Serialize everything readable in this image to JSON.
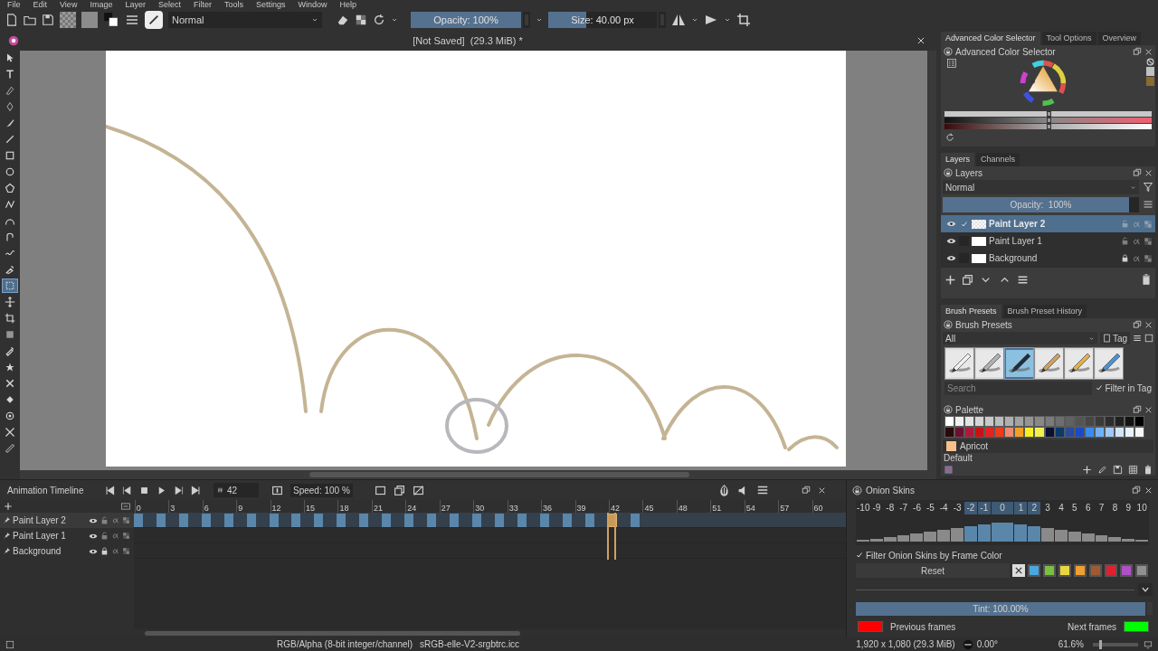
{
  "menu": [
    "File",
    "Edit",
    "View",
    "Image",
    "Layer",
    "Select",
    "Filter",
    "Tools",
    "Settings",
    "Window",
    "Help"
  ],
  "toolbar": {
    "blend_mode": "Normal",
    "opacity": {
      "text": "Opacity: 100%",
      "level": 1
    },
    "size": {
      "text": "Size: 40.00 px",
      "level": 0.35
    }
  },
  "document_tab": {
    "title": "[Not Saved]  (29.3 MiB) *"
  },
  "tools": [
    {
      "kind": "pointer",
      "selected": false
    },
    {
      "kind": "text",
      "selected": false
    },
    {
      "kind": "pen",
      "selected": false
    },
    {
      "kind": "nib",
      "selected": false
    },
    {
      "kind": "brush",
      "selected": false
    },
    {
      "kind": "line",
      "selected": false
    },
    {
      "kind": "rectangle",
      "selected": false
    },
    {
      "kind": "ellipse",
      "selected": false
    },
    {
      "kind": "polygon",
      "selected": false
    },
    {
      "kind": "polyline",
      "selected": false
    },
    {
      "kind": "bezier",
      "selected": false
    },
    {
      "kind": "hook",
      "selected": false
    },
    {
      "kind": "wave",
      "selected": false
    },
    {
      "kind": "spray",
      "selected": false
    },
    {
      "kind": "select",
      "selected": true
    },
    {
      "kind": "move",
      "selected": false
    },
    {
      "kind": "crop",
      "selected": false
    },
    {
      "kind": "gradient",
      "selected": false
    },
    {
      "kind": "eyedropper",
      "selected": false
    },
    {
      "kind": "star",
      "selected": false
    },
    {
      "kind": "patch",
      "selected": false
    },
    {
      "kind": "bucket",
      "selected": false
    },
    {
      "kind": "target",
      "selected": false
    },
    {
      "kind": "assistant",
      "selected": false
    },
    {
      "kind": "ruler",
      "selected": false
    }
  ],
  "right_dock": {
    "top_tabs": [
      {
        "label": "Advanced Color Selector",
        "selected": true
      },
      {
        "label": "Tool Options",
        "selected": false
      },
      {
        "label": "Overview",
        "selected": false
      }
    ],
    "color_selector": {
      "title": "Advanced Color Selector",
      "sliders": [
        {
          "level": 0.5
        },
        {
          "level": 0.5
        },
        {
          "level": 0.5
        }
      ]
    },
    "layer_tabs": [
      {
        "label": "Layers",
        "selected": true
      },
      {
        "label": "Channels",
        "selected": false
      }
    ],
    "layers": {
      "title": "Layers",
      "blend_mode": "Normal",
      "opacity": {
        "text": "Opacity:  100%",
        "level": 1
      },
      "items": [
        {
          "name": "Paint Layer 2",
          "selected": true,
          "checked": true,
          "locked": false
        },
        {
          "name": "Paint Layer 1",
          "selected": false,
          "checked": false,
          "locked": false
        },
        {
          "name": "Background",
          "selected": false,
          "checked": false,
          "locked": true
        }
      ]
    },
    "brush_tabs": [
      {
        "label": "Brush Presets",
        "selected": true
      },
      {
        "label": "Brush Preset History",
        "selected": false
      }
    ],
    "brush_presets": {
      "title": "Brush Presets",
      "filter": "All",
      "tag": "Tag",
      "search_placeholder": "Search",
      "filter_in_tag": {
        "label": "Filter in Tag",
        "checked": true
      },
      "items": [
        {
          "kind": "picture",
          "selected": false
        },
        {
          "kind": "picture",
          "selected": false
        },
        {
          "kind": "picture",
          "selected": true
        },
        {
          "kind": "picture",
          "selected": false
        },
        {
          "kind": "picture",
          "selected": false
        },
        {
          "kind": "picture",
          "selected": false
        }
      ]
    },
    "palette": {
      "title": "Palette",
      "colors": [
        {
          "color": "#ffffff"
        },
        {
          "color": "#f0f0f0"
        },
        {
          "color": "#e3e3e3"
        },
        {
          "color": "#d6d6d6"
        },
        {
          "color": "#c9c9c9"
        },
        {
          "color": "#bcbcbc"
        },
        {
          "color": "#afafaf"
        },
        {
          "color": "#a2a2a2"
        },
        {
          "color": "#959595"
        },
        {
          "color": "#888888"
        },
        {
          "color": "#7b7b7b"
        },
        {
          "color": "#6e6e6e"
        },
        {
          "color": "#616161"
        },
        {
          "color": "#545454"
        },
        {
          "color": "#474747"
        },
        {
          "color": "#3a3a3a"
        },
        {
          "color": "#2d2d2d"
        },
        {
          "color": "#202020"
        },
        {
          "color": "#131313"
        },
        {
          "color": "#000000"
        },
        {
          "color": "#2a0a0a"
        },
        {
          "color": "#6b1030"
        },
        {
          "color": "#b0183a"
        },
        {
          "color": "#cc1010"
        },
        {
          "color": "#e82020"
        },
        {
          "color": "#f03a18"
        },
        {
          "color": "#f08a70"
        },
        {
          "color": "#f5a020"
        },
        {
          "color": "#f8f020"
        },
        {
          "color": "#f0f050"
        },
        {
          "color": "#0a1030"
        },
        {
          "color": "#0a3a6a"
        },
        {
          "color": "#2a4a9a"
        },
        {
          "color": "#1a4ac8"
        },
        {
          "color": "#3a8af0"
        },
        {
          "color": "#70b0f8"
        },
        {
          "color": "#a0c8f8"
        },
        {
          "color": "#d0e4fa"
        },
        {
          "color": "#e8f2fc"
        },
        {
          "color": "#f4f8fc"
        }
      ],
      "current": {
        "name": "Apricot",
        "color": "#f8c08a"
      },
      "palette_name": "Default"
    }
  },
  "timeline": {
    "title": "Animation Timeline",
    "frame": "42",
    "speed": "Speed: 100 %",
    "frame_labels": [
      "0",
      "3",
      "6",
      "9",
      "12",
      "15",
      "18",
      "21",
      "24",
      "27",
      "30",
      "33",
      "36",
      "39",
      "42",
      "45",
      "48",
      "51",
      "54",
      "57",
      "60"
    ],
    "layers": [
      {
        "name": "Paint Layer 2",
        "selected": true,
        "locked": false,
        "keyframes": [
          {
            "selected": false
          },
          {
            "selected": false
          },
          {
            "selected": false
          },
          {
            "selected": false
          },
          {
            "selected": false
          },
          {
            "selected": false
          },
          {
            "selected": false
          },
          {
            "selected": false
          },
          {
            "selected": false
          },
          {
            "selected": false
          },
          {
            "selected": false
          },
          {
            "selected": false
          },
          {
            "selected": false
          },
          {
            "selected": false
          },
          {
            "selected": false
          },
          {
            "selected": false
          },
          {
            "selected": false
          },
          {
            "selected": false
          },
          {
            "selected": false
          },
          {
            "selected": false
          },
          {
            "selected": false
          },
          {
            "selected": true
          },
          {
            "selected": false
          }
        ]
      },
      {
        "name": "Paint Layer 1",
        "selected": false,
        "locked": false
      },
      {
        "name": "Background",
        "selected": false,
        "locked": true
      }
    ]
  },
  "onion_skins": {
    "title": "Onion Skins",
    "frames": [
      {
        "label": "-10",
        "selected": false
      },
      {
        "label": "-9",
        "selected": false
      },
      {
        "label": "-8",
        "selected": false
      },
      {
        "label": "-7",
        "selected": false
      },
      {
        "label": "-6",
        "selected": false
      },
      {
        "label": "-5",
        "selected": false
      },
      {
        "label": "-4",
        "selected": false
      },
      {
        "label": "-3",
        "selected": false
      },
      {
        "label": "-2",
        "selected": true
      },
      {
        "label": "-1",
        "selected": true
      },
      {
        "label": "0",
        "selected": true
      },
      {
        "label": "1",
        "selected": true
      },
      {
        "label": "2",
        "selected": true
      },
      {
        "label": "3",
        "selected": false
      },
      {
        "label": "4",
        "selected": false
      },
      {
        "label": "5",
        "selected": false
      },
      {
        "label": "6",
        "selected": false
      },
      {
        "label": "7",
        "selected": false
      },
      {
        "label": "8",
        "selected": false
      },
      {
        "label": "9",
        "selected": false
      },
      {
        "label": "10",
        "selected": false
      }
    ],
    "filter": {
      "label": "Filter Onion Skins by Frame Color",
      "checked": true
    },
    "reset": "Reset",
    "colors": [
      {
        "kind": "none"
      },
      {
        "kind": "swatch",
        "color": "#4aa8e0"
      },
      {
        "kind": "swatch",
        "color": "#78c040"
      },
      {
        "kind": "swatch",
        "color": "#e8d840"
      },
      {
        "kind": "swatch",
        "color": "#f0a030"
      },
      {
        "kind": "swatch",
        "color": "#a05a30"
      },
      {
        "kind": "swatch",
        "color": "#e02030"
      },
      {
        "kind": "swatch",
        "color": "#b050c8"
      },
      {
        "kind": "swatch",
        "color": "#909090"
      }
    ],
    "tint": {
      "text": "Tint: 100.00%",
      "level": 1
    },
    "previous": {
      "label": "Previous frames",
      "color": "#ff0000"
    },
    "next": {
      "label": "Next frames",
      "color": "#00ff00"
    }
  },
  "status_bar": {
    "color_space": "RGB/Alpha (8-bit integer/channel)",
    "profile": "sRGB-elle-V2-srgbtrc.icc",
    "dimensions": "1,920 x 1,080 (29.3 MiB)",
    "rotation": "0.00°",
    "zoom": "61.6%",
    "zoom_slider": {
      "level": 0.15
    }
  }
}
